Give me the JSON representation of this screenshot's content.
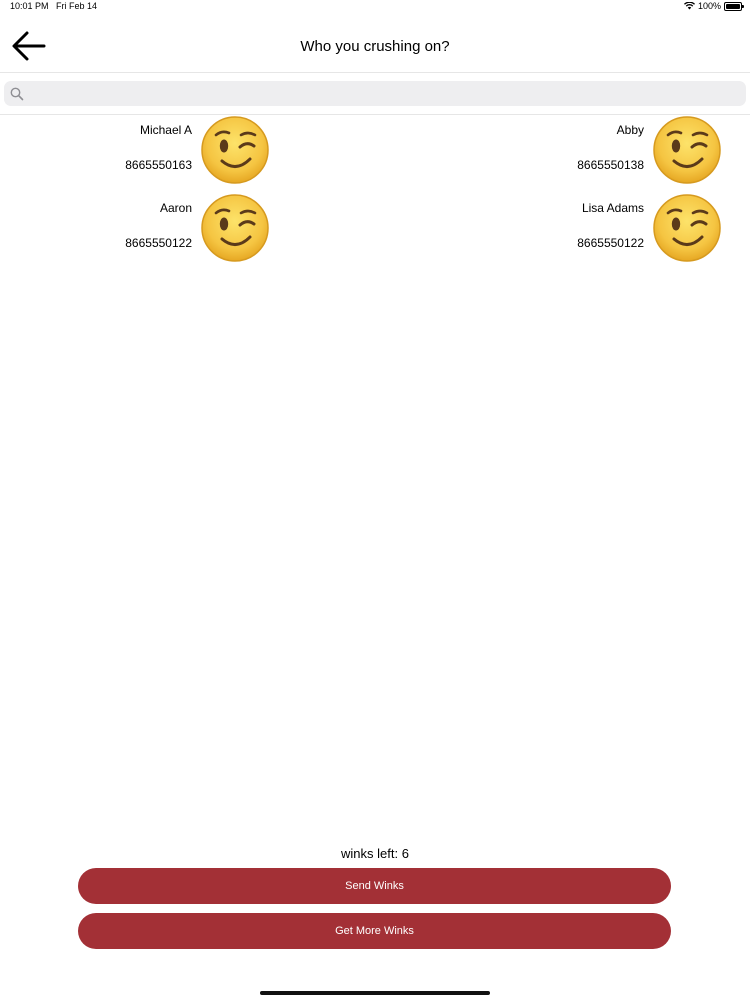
{
  "status": {
    "time": "10:01 PM",
    "date": "Fri Feb 14",
    "battery": "100%"
  },
  "nav": {
    "title": "Who you crushing on?",
    "back_icon": "arrow-left-icon"
  },
  "search": {
    "placeholder": "",
    "value": "",
    "icon": "search-icon"
  },
  "contacts": [
    {
      "name": "Michael A",
      "phone": "8665550163",
      "icon": "winking-face-emoji"
    },
    {
      "name": "Abby",
      "phone": "8665550138",
      "icon": "winking-face-emoji"
    },
    {
      "name": "Aaron",
      "phone": "8665550122",
      "icon": "winking-face-emoji"
    },
    {
      "name": "Lisa Adams",
      "phone": "8665550122",
      "icon": "winking-face-emoji"
    }
  ],
  "footer": {
    "winks_left": "winks left: 6",
    "send_label": "Send Winks",
    "more_label": "Get More Winks"
  },
  "colors": {
    "button_bg": "#a33036",
    "button_text": "#ffffff"
  }
}
